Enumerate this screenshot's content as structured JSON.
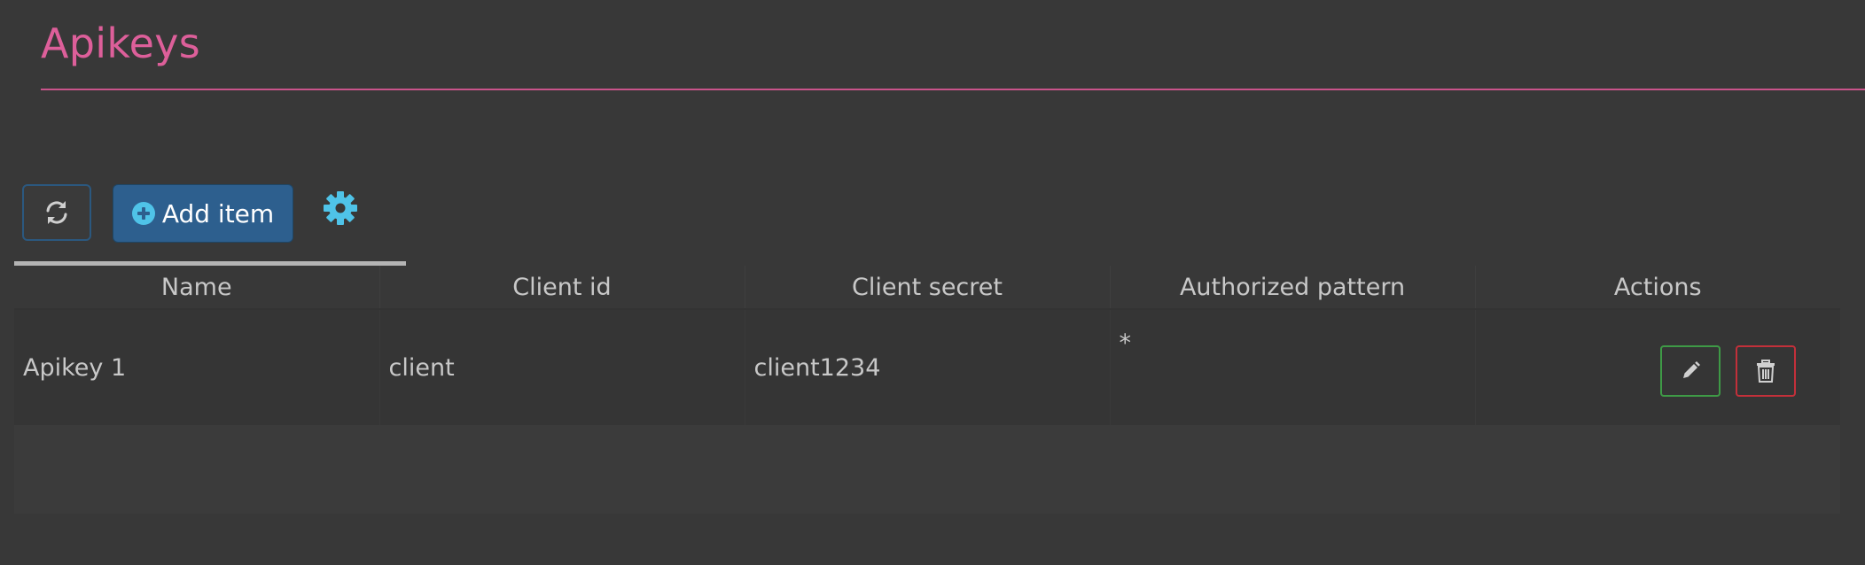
{
  "page": {
    "title": "Apikeys"
  },
  "toolbar": {
    "refresh_icon": "refresh-icon",
    "add_item_label": "Add item",
    "add_icon": "plus-circle-icon",
    "settings_icon": "gear-icon"
  },
  "table": {
    "columns": [
      "Name",
      "Client id",
      "Client secret",
      "Authorized pattern",
      "Actions"
    ],
    "rows": [
      {
        "name": "Apikey 1",
        "client_id": "client",
        "client_secret": "client1234",
        "authorized_pattern": "*",
        "actions": [
          "edit-icon",
          "trash-icon"
        ]
      }
    ]
  },
  "colors": {
    "background": "#383838",
    "title_accent": "#dd5f9a",
    "primary_button": "#2d5f8e",
    "icon_accent": "#4fc3e8",
    "edit_border": "#3e9a46",
    "delete_border": "#c3303a"
  }
}
